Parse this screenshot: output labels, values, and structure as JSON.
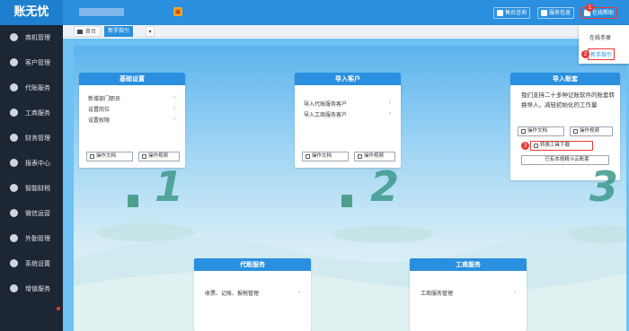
{
  "app": {
    "title": "账无忧"
  },
  "topbar": {
    "service_consult": "售后咨询",
    "service_info": "服务信息",
    "online_help": "在线帮助"
  },
  "dropdown": {
    "items": [
      "在线手册",
      "新手指引"
    ]
  },
  "markers": [
    "1",
    "2",
    "3"
  ],
  "sidebar": {
    "items": [
      {
        "label": "商机管理",
        "icon": "target-icon"
      },
      {
        "label": "客户管理",
        "icon": "customers-icon"
      },
      {
        "label": "代账服务",
        "icon": "pen-icon"
      },
      {
        "label": "工商服务",
        "icon": "building-icon"
      },
      {
        "label": "财务管理",
        "icon": "finance-icon"
      },
      {
        "label": "报表中心",
        "icon": "report-icon"
      },
      {
        "label": "智能财税",
        "icon": "smart-icon"
      },
      {
        "label": "微信运营",
        "icon": "wechat-icon"
      },
      {
        "label": "外勤管理",
        "icon": "location-icon"
      },
      {
        "label": "系统设置",
        "icon": "gear-icon"
      },
      {
        "label": "增值服务",
        "icon": "crown-icon"
      }
    ]
  },
  "tabs": {
    "home": "首页",
    "guide": "新手指引",
    "more": "▾"
  },
  "cards": {
    "basic": {
      "title": "基础设置",
      "rows": [
        "新增部门职员",
        "设置岗位",
        "设置权限"
      ],
      "doc_btn": "操作文档",
      "video_btn": "操作视频",
      "step": "1"
    },
    "import_customer": {
      "title": "导入客户",
      "rows": [
        "导入代账服务客户",
        "导入工商服务客户"
      ],
      "doc_btn": "操作文档",
      "video_btn": "操作视频",
      "step": "2"
    },
    "import_account": {
      "title": "导入账套",
      "desc": "我们支持二十多种记账软件的账套转换导入，减轻初始化的工作量",
      "doc_btn": "操作文档",
      "video_btn": "操作视频",
      "tool_btn": "转换工具下载",
      "cloud_btn": "已有本规精斗云账套",
      "step": "3"
    },
    "agency": {
      "title": "代账服务",
      "rows": [
        "收票、记账、报税管理"
      ]
    },
    "business": {
      "title": "工商服务",
      "rows": [
        "工商服务管理"
      ]
    }
  },
  "colors": {
    "primary": "#2a8fde",
    "sidebar": "#1d2734",
    "marker": "#e53935"
  }
}
